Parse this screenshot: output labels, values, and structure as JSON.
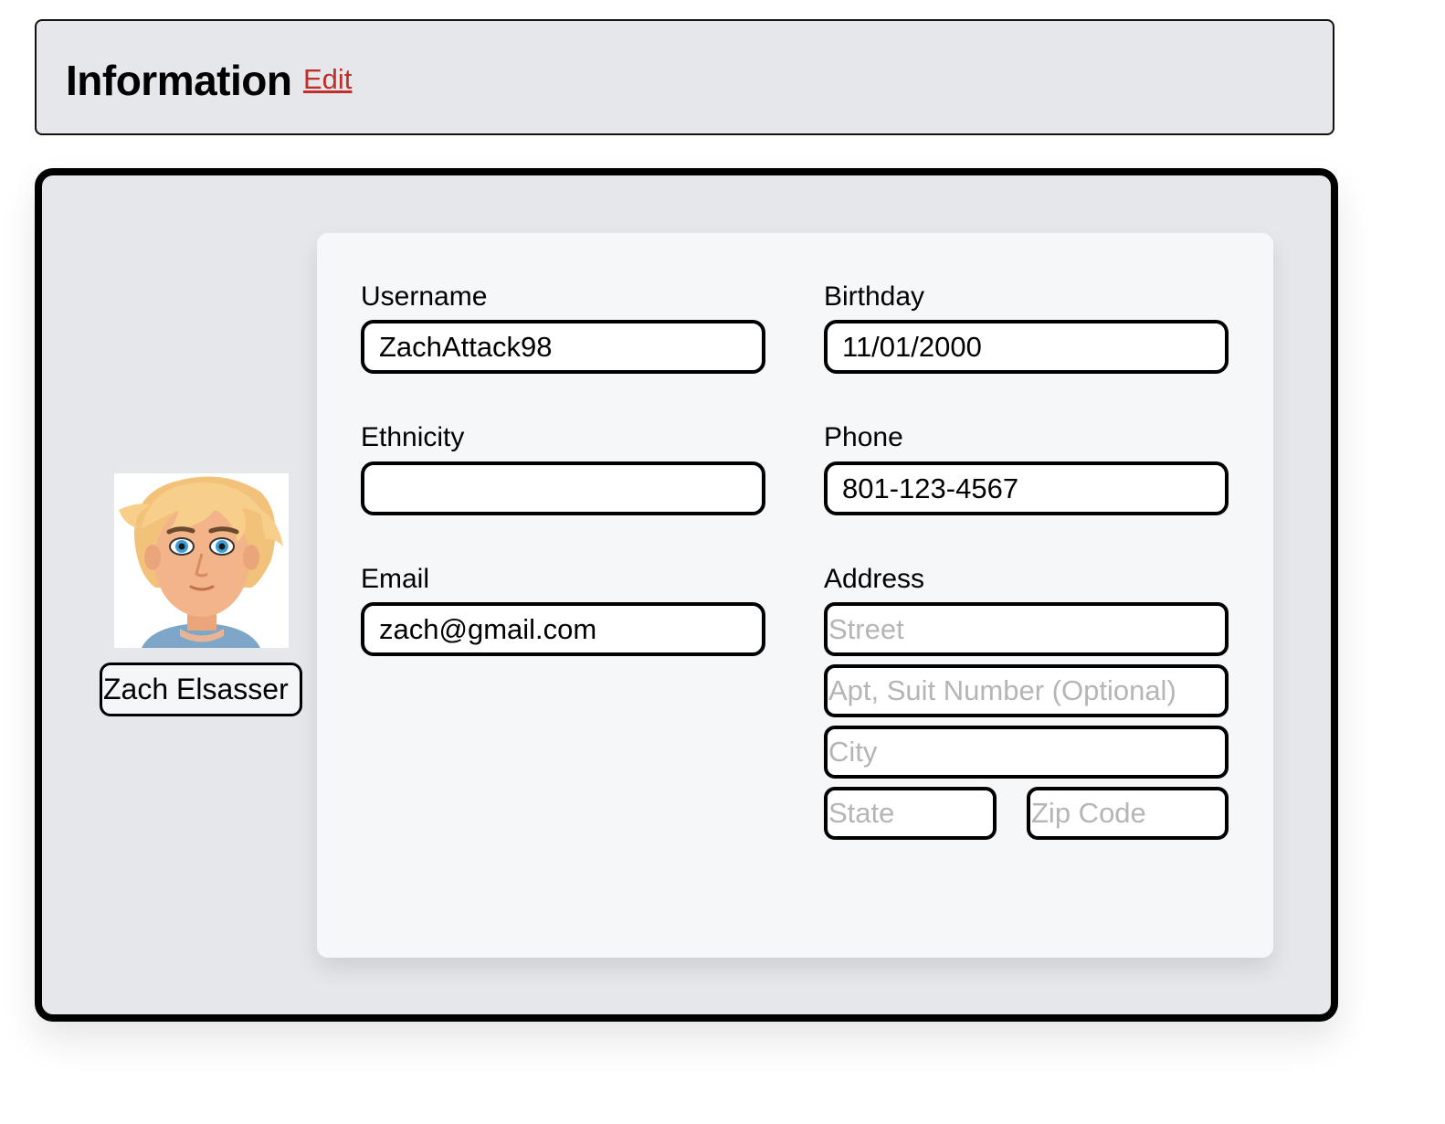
{
  "header": {
    "title": "Information",
    "edit_label": "Edit"
  },
  "profile": {
    "name": "Zach Elsasser",
    "avatar_icon": "cartoon-avatar-icon"
  },
  "form": {
    "username": {
      "label": "Username",
      "value": "ZachAttack98"
    },
    "birthday": {
      "label": "Birthday",
      "value": "11/01/2000"
    },
    "ethnicity": {
      "label": "Ethnicity",
      "value": ""
    },
    "phone": {
      "label": "Phone",
      "value": "801-123-4567"
    },
    "email": {
      "label": "Email",
      "value": "zach@gmail.com"
    },
    "address": {
      "label": "Address",
      "street_placeholder": "Street",
      "apt_placeholder": "Apt, Suit Number (Optional)",
      "city_placeholder": "City",
      "state_placeholder": "State",
      "zip_placeholder": "Zip Code"
    }
  },
  "colors": {
    "edit_link": "#c0302a",
    "panel_bg": "#e5e7eb",
    "card_bg": "#f6f7f9"
  }
}
